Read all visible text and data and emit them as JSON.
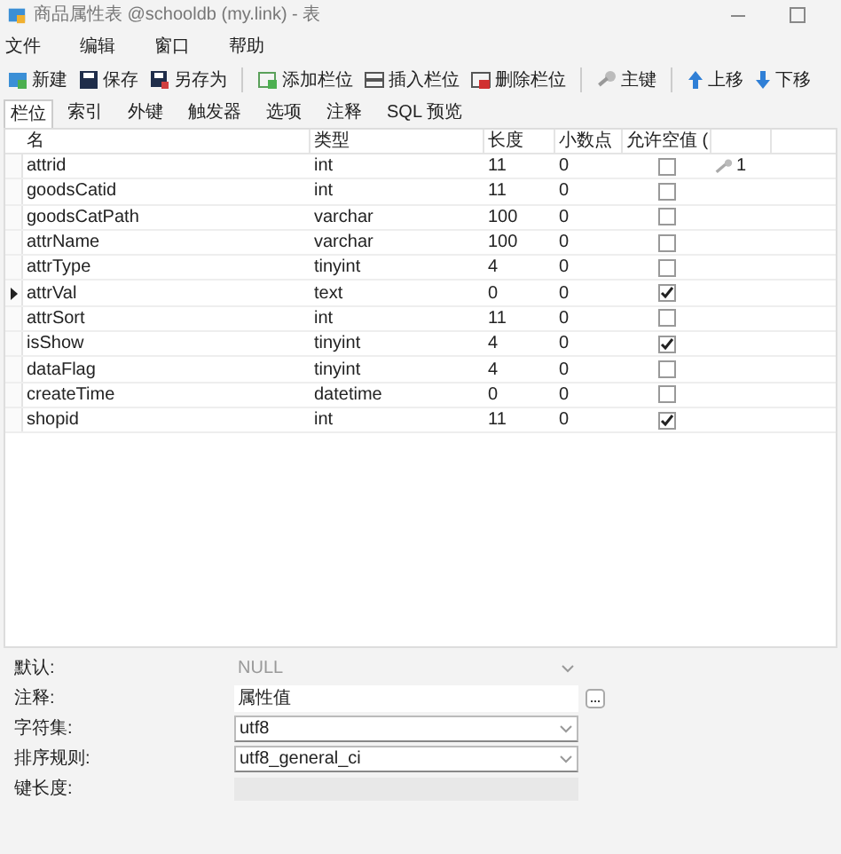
{
  "window": {
    "title": "商品属性表 @schooldb (my.link) - 表"
  },
  "menu": [
    "文件",
    "编辑",
    "窗口",
    "帮助"
  ],
  "toolbar": [
    {
      "kind": "new",
      "label": "新建"
    },
    {
      "kind": "save",
      "label": "保存"
    },
    {
      "kind": "saveas",
      "label": "另存为"
    },
    {
      "kind": "sep"
    },
    {
      "kind": "addcol",
      "label": "添加栏位"
    },
    {
      "kind": "insertcol",
      "label": "插入栏位"
    },
    {
      "kind": "deletecol",
      "label": "删除栏位"
    },
    {
      "kind": "sep"
    },
    {
      "kind": "key",
      "label": "主键"
    },
    {
      "kind": "sep"
    },
    {
      "kind": "up",
      "label": "上移"
    },
    {
      "kind": "down",
      "label": "下移"
    }
  ],
  "tabs": [
    {
      "label": "栏位",
      "selected": true
    },
    {
      "label": "索引",
      "selected": false
    },
    {
      "label": "外键",
      "selected": false
    },
    {
      "label": "触发器",
      "selected": false
    },
    {
      "label": "选项",
      "selected": false
    },
    {
      "label": "注释",
      "selected": false
    },
    {
      "label": "SQL 预览",
      "selected": false
    }
  ],
  "table": {
    "columns": [
      "名",
      "类型",
      "长度",
      "小数点",
      "允许空值 ("
    ],
    "rows": [
      {
        "name": "attrid",
        "type": "int",
        "length": "11",
        "decimals": "0",
        "nullable": false,
        "key": "1",
        "selected": false
      },
      {
        "name": "goodsCatid",
        "type": "int",
        "length": "11",
        "decimals": "0",
        "nullable": false,
        "selected": false
      },
      {
        "name": "goodsCatPath",
        "type": "varchar",
        "length": "100",
        "decimals": "0",
        "nullable": false,
        "selected": false
      },
      {
        "name": "attrName",
        "type": "varchar",
        "length": "100",
        "decimals": "0",
        "nullable": false,
        "selected": false
      },
      {
        "name": "attrType",
        "type": "tinyint",
        "length": "4",
        "decimals": "0",
        "nullable": false,
        "selected": false
      },
      {
        "name": "attrVal",
        "type": "text",
        "length": "0",
        "decimals": "0",
        "nullable": true,
        "selected": true
      },
      {
        "name": "attrSort",
        "type": "int",
        "length": "11",
        "decimals": "0",
        "nullable": false,
        "selected": false
      },
      {
        "name": "isShow",
        "type": "tinyint",
        "length": "4",
        "decimals": "0",
        "nullable": true,
        "selected": false
      },
      {
        "name": "dataFlag",
        "type": "tinyint",
        "length": "4",
        "decimals": "0",
        "nullable": false,
        "selected": false
      },
      {
        "name": "createTime",
        "type": "datetime",
        "length": "0",
        "decimals": "0",
        "nullable": false,
        "selected": false
      },
      {
        "name": "shopid",
        "type": "int",
        "length": "11",
        "decimals": "0",
        "nullable": true,
        "selected": false
      }
    ]
  },
  "properties": [
    {
      "kind": "select",
      "label": "默认:",
      "value": "NULL",
      "disabled": true
    },
    {
      "kind": "text",
      "label": "注释:",
      "value": "属性值"
    },
    {
      "kind": "select",
      "label": "字符集:",
      "value": "utf8",
      "disabled": false
    },
    {
      "kind": "select",
      "label": "排序规则:",
      "value": "utf8_general_ci",
      "disabled": false
    },
    {
      "kind": "empty",
      "label": "键长度:"
    }
  ]
}
